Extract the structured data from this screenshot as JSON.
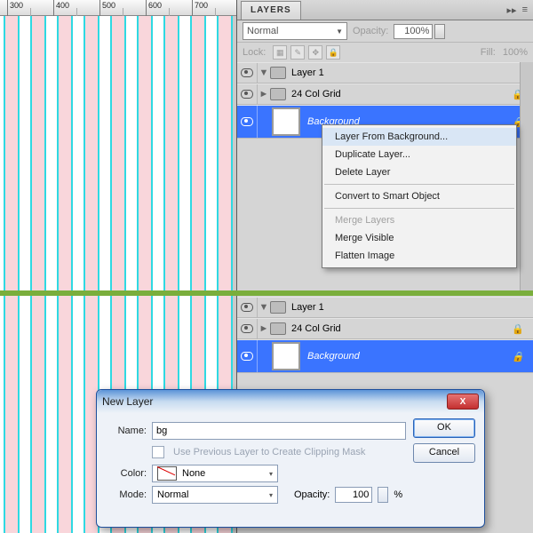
{
  "ruler": {
    "marks": [
      "300",
      "400",
      "500",
      "600",
      "700"
    ]
  },
  "panel": {
    "tab": "LAYERS",
    "blend_mode": "Normal",
    "opacity_label": "Opacity:",
    "opacity_value": "100%",
    "lock_label": "Lock:",
    "fill_label": "Fill:",
    "fill_value": "100%"
  },
  "layers_top": [
    {
      "name": "Layer 1",
      "kind": "group",
      "twist": "▼",
      "locked": false
    },
    {
      "name": "24 Col Grid",
      "kind": "group",
      "twist": "►",
      "locked": true
    },
    {
      "name": "Background",
      "kind": "bg",
      "locked": true
    }
  ],
  "layers_bottom": [
    {
      "name": "Layer 1",
      "kind": "group",
      "twist": "▼",
      "locked": false
    },
    {
      "name": "24 Col Grid",
      "kind": "group",
      "twist": "►",
      "locked": true
    },
    {
      "name": "Background",
      "kind": "bg",
      "locked": true
    }
  ],
  "context_menu": {
    "items": [
      {
        "label": "Layer From Background...",
        "hover": true
      },
      {
        "label": "Duplicate Layer..."
      },
      {
        "label": "Delete Layer"
      },
      {
        "sep": true
      },
      {
        "label": "Convert to Smart Object"
      },
      {
        "sep": true
      },
      {
        "label": "Merge Layers",
        "disabled": true
      },
      {
        "label": "Merge Visible"
      },
      {
        "label": "Flatten Image"
      }
    ]
  },
  "dialog": {
    "title": "New Layer",
    "name_label": "Name:",
    "name_value": "bg",
    "clip_label": "Use Previous Layer to Create Clipping Mask",
    "color_label": "Color:",
    "color_value": "None",
    "mode_label": "Mode:",
    "mode_value": "Normal",
    "opacity_label": "Opacity:",
    "opacity_value": "100",
    "pct": "%",
    "ok": "OK",
    "cancel": "Cancel"
  }
}
